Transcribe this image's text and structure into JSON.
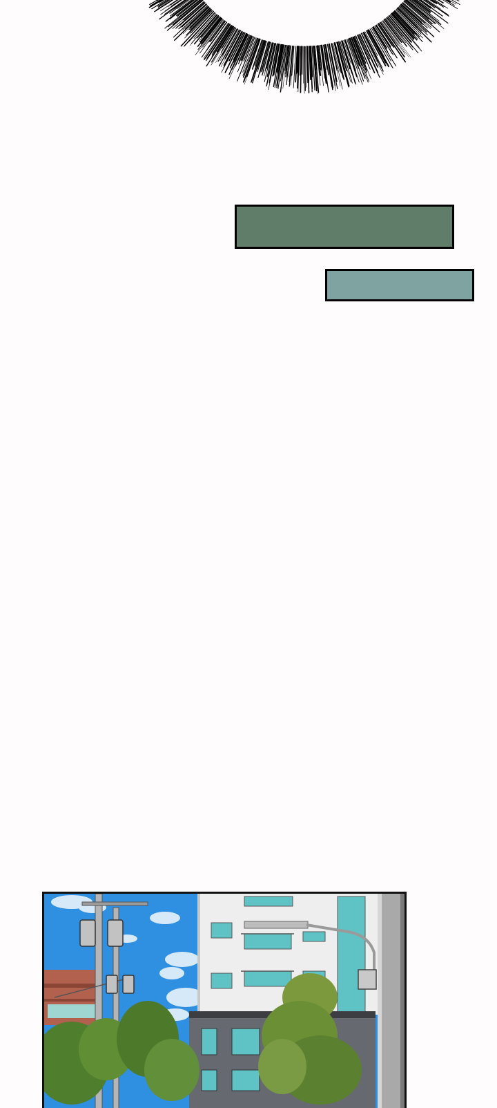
{
  "captions": [
    {
      "text": "",
      "color": "#5f7d68"
    },
    {
      "text": "",
      "color": "#7fa3a1"
    }
  ],
  "colors": {
    "background": "#fffcfd",
    "lashes": "#000000",
    "panel_border": "#111111",
    "sky": "#2f8fe0",
    "foliage": "#5f8e34"
  },
  "illustration": {
    "subject": "street-scene",
    "elements": [
      "sky",
      "clouds",
      "apartment-building",
      "brick-building",
      "utility-pole",
      "traffic-signals",
      "street-light",
      "trees"
    ]
  }
}
